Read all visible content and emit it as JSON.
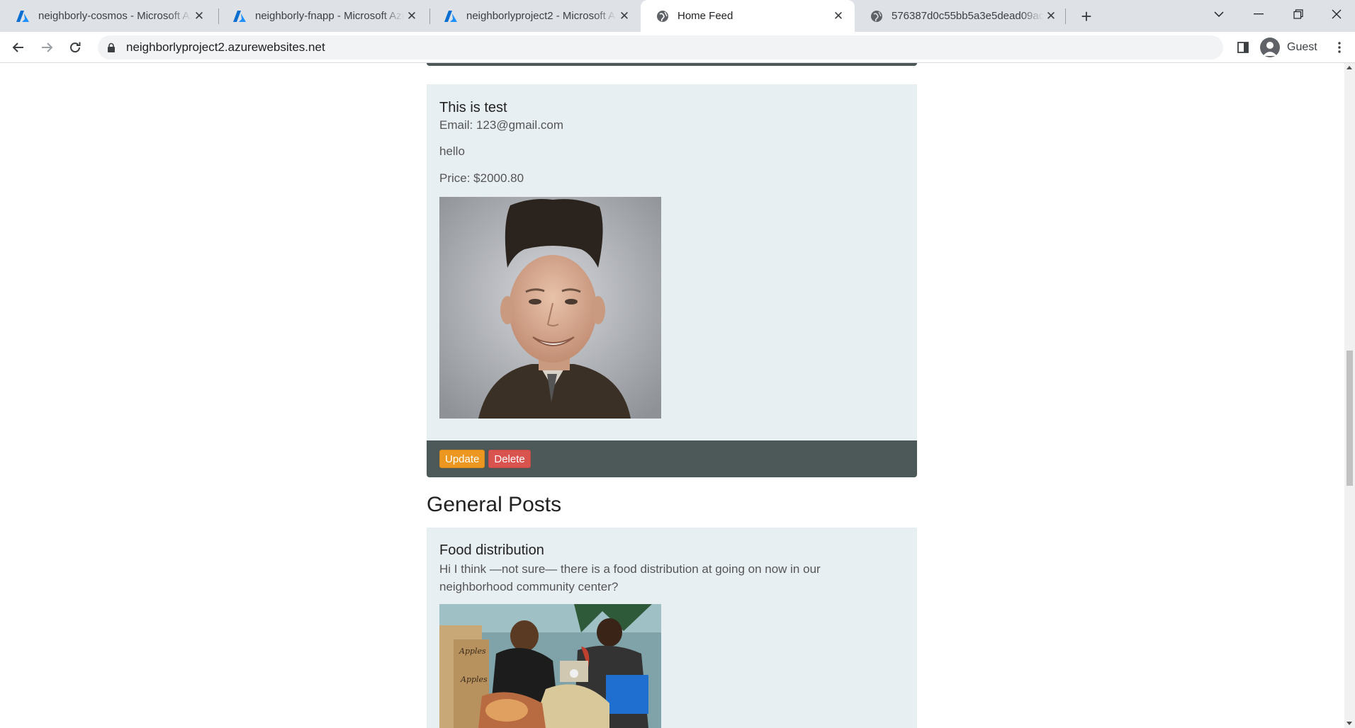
{
  "browser": {
    "tabs": [
      {
        "title": "neighborly-cosmos - Microsoft Azure",
        "icon": "azure-icon",
        "active": false
      },
      {
        "title": "neighborly-fnapp - Microsoft Azure",
        "icon": "azure-icon",
        "active": false
      },
      {
        "title": "neighborlyproject2 - Microsoft Azure",
        "icon": "azure-icon",
        "active": false
      },
      {
        "title": "Home Feed",
        "icon": "globe-icon",
        "active": true
      },
      {
        "title": "576387d0c55bb5a3e5dead09ac5",
        "icon": "globe-icon",
        "active": false
      }
    ],
    "url": "neighborlyproject2.azurewebsites.net",
    "profile_label": "Guest"
  },
  "page": {
    "post": {
      "title": "This is test",
      "email": "Email: 123@gmail.com",
      "description": "hello",
      "price": "Price: $2000.80",
      "image_alt": "portrait photo",
      "update_label": "Update",
      "delete_label": "Delete"
    },
    "general_heading": "General Posts",
    "general_post": {
      "title": "Food distribution",
      "text": "Hi I think —not sure— there is a food distribution at going on now in our neighborhood community center?",
      "image_alt": "food distribution photo"
    }
  },
  "colors": {
    "card_bg": "#e8eff3",
    "card_footer": "#4d5858",
    "update_button": "#ec971f",
    "delete_button": "#d9534f"
  }
}
